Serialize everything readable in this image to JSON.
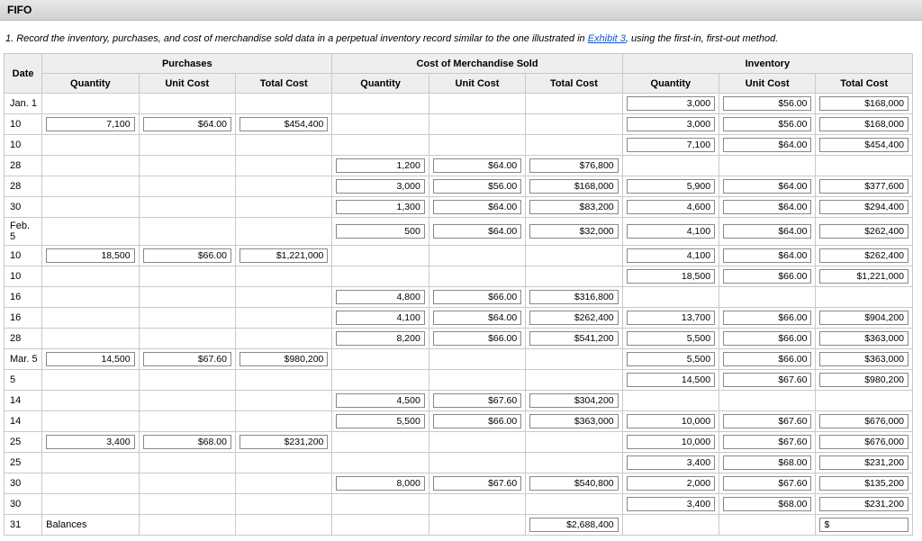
{
  "title": "FIFO",
  "instruction_pre": "1. Record the inventory, purchases, and cost of merchandise sold data in a perpetual inventory record similar to the one illustrated in ",
  "instruction_link": "Exhibit 3",
  "instruction_post": ", using the first-in, first-out method.",
  "headers": {
    "date": "Date",
    "purchases": "Purchases",
    "cogs": "Cost of Merchandise Sold",
    "inventory": "Inventory",
    "qty": "Quantity",
    "uc": "Unit Cost",
    "tc": "Total Cost"
  },
  "rows": [
    {
      "date": "Jan. 1",
      "p": {},
      "c": {},
      "i": {
        "q": "3,000",
        "u": "$56.00",
        "t": "$168,000"
      }
    },
    {
      "date": "10",
      "p": {
        "q": "7,100",
        "u": "$64.00",
        "t": "$454,400"
      },
      "c": {},
      "i": {
        "q": "3,000",
        "u": "$56.00",
        "t": "$168,000"
      }
    },
    {
      "date": "10",
      "p": {},
      "c": {},
      "i": {
        "q": "7,100",
        "u": "$64.00",
        "t": "$454,400"
      }
    },
    {
      "date": "28",
      "p": {},
      "c": {
        "q": "1,200",
        "u": "$64.00",
        "t": "$76,800"
      },
      "i": {}
    },
    {
      "date": "28",
      "p": {},
      "c": {
        "q": "3,000",
        "u": "$56.00",
        "t": "$168,000"
      },
      "i": {
        "q": "5,900",
        "u": "$64.00",
        "t": "$377,600"
      }
    },
    {
      "date": "30",
      "p": {},
      "c": {
        "q": "1,300",
        "u": "$64.00",
        "t": "$83,200"
      },
      "i": {
        "q": "4,600",
        "u": "$64.00",
        "t": "$294,400"
      }
    },
    {
      "date": "Feb. 5",
      "p": {},
      "c": {
        "q": "500",
        "u": "$64.00",
        "t": "$32,000"
      },
      "i": {
        "q": "4,100",
        "u": "$64.00",
        "t": "$262,400"
      }
    },
    {
      "date": "10",
      "p": {
        "q": "18,500",
        "u": "$66.00",
        "t": "$1,221,000"
      },
      "c": {},
      "i": {
        "q": "4,100",
        "u": "$64.00",
        "t": "$262,400"
      }
    },
    {
      "date": "10",
      "p": {},
      "c": {},
      "i": {
        "q": "18,500",
        "u": "$66.00",
        "t": "$1,221,000"
      }
    },
    {
      "date": "16",
      "p": {},
      "c": {
        "q": "4,800",
        "u": "$66.00",
        "t": "$316,800"
      },
      "i": {}
    },
    {
      "date": "16",
      "p": {},
      "c": {
        "q": "4,100",
        "u": "$64.00",
        "t": "$262,400"
      },
      "i": {
        "q": "13,700",
        "u": "$66.00",
        "t": "$904,200"
      }
    },
    {
      "date": "28",
      "p": {},
      "c": {
        "q": "8,200",
        "u": "$66.00",
        "t": "$541,200"
      },
      "i": {
        "q": "5,500",
        "u": "$66.00",
        "t": "$363,000"
      }
    },
    {
      "date": "Mar. 5",
      "p": {
        "q": "14,500",
        "u": "$67.60",
        "t": "$980,200"
      },
      "c": {},
      "i": {
        "q": "5,500",
        "u": "$66.00",
        "t": "$363,000"
      }
    },
    {
      "date": "5",
      "p": {},
      "c": {},
      "i": {
        "q": "14,500",
        "u": "$67.60",
        "t": "$980,200"
      }
    },
    {
      "date": "14",
      "p": {},
      "c": {
        "q": "4,500",
        "u": "$67.60",
        "t": "$304,200"
      },
      "i": {}
    },
    {
      "date": "14",
      "p": {},
      "c": {
        "q": "5,500",
        "u": "$66.00",
        "t": "$363,000"
      },
      "i": {
        "q": "10,000",
        "u": "$67.60",
        "t": "$676,000"
      }
    },
    {
      "date": "25",
      "p": {
        "q": "3,400",
        "u": "$68.00",
        "t": "$231,200"
      },
      "c": {},
      "i": {
        "q": "10,000",
        "u": "$67.60",
        "t": "$676,000"
      }
    },
    {
      "date": "25",
      "p": {},
      "c": {},
      "i": {
        "q": "3,400",
        "u": "$68.00",
        "t": "$231,200"
      }
    },
    {
      "date": "30",
      "p": {},
      "c": {
        "q": "8,000",
        "u": "$67.60",
        "t": "$540,800"
      },
      "i": {
        "q": "2,000",
        "u": "$67.60",
        "t": "$135,200"
      }
    },
    {
      "date": "30",
      "p": {},
      "c": {},
      "i": {
        "q": "3,400",
        "u": "$68.00",
        "t": "$231,200"
      }
    }
  ],
  "balances_row": {
    "date": "31",
    "label": "Balances",
    "cogs_total": "$2,688,400",
    "inv_total": "$"
  }
}
